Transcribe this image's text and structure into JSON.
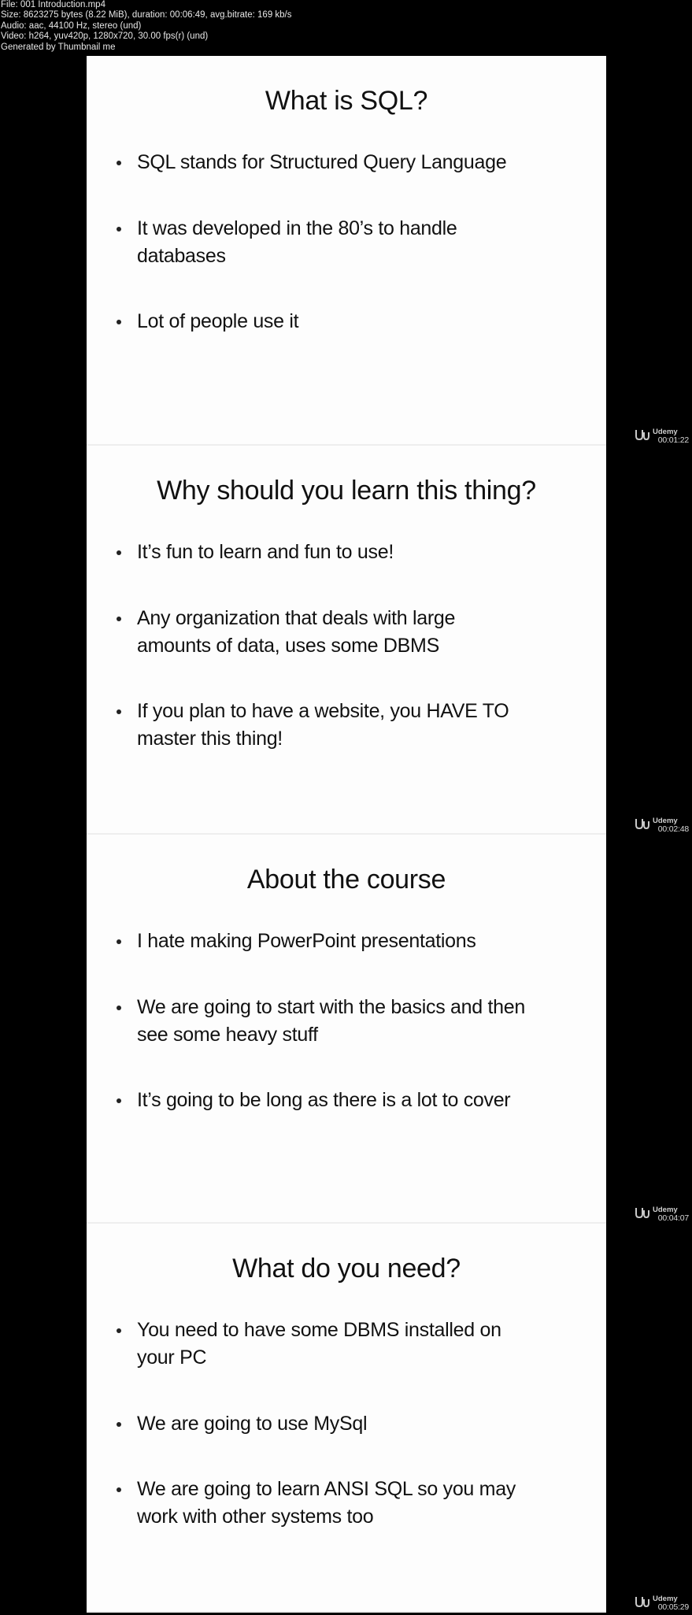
{
  "file_info": {
    "lines": [
      "File: 001 Introduction.mp4",
      "Size: 8623275 bytes (8.22 MiB), duration: 00:06:49, avg.bitrate: 169 kb/s",
      "Audio: aac, 44100 Hz, stereo (und)",
      "Video: h264, yuv420p, 1280x720, 30.00 fps(r) (und)",
      "Generated by Thumbnail me"
    ]
  },
  "watermark": {
    "brand": "Udemy",
    "icon": "udemy-logo-icon"
  },
  "slides": [
    {
      "title": "What is SQL?",
      "timestamp": "00:01:22",
      "bullets": [
        [
          "SQL stands for Structured Query Language"
        ],
        [
          "It was developed in the 80’s to handle",
          "databases"
        ],
        [
          "Lot of people use it"
        ]
      ]
    },
    {
      "title": "Why should you learn this thing?",
      "timestamp": "00:02:48",
      "bullets": [
        [
          "It’s fun to learn and fun to use!"
        ],
        [
          "Any organization that deals with large",
          "amounts of data, uses some DBMS"
        ],
        [
          "If you plan to have a website, you HAVE TO",
          "master this thing!"
        ]
      ]
    },
    {
      "title": "About the course",
      "timestamp": "00:04:07",
      "bullets": [
        [
          "I hate making PowerPoint presentations"
        ],
        [
          "We are going to start with the basics and then",
          "see some heavy stuff"
        ],
        [
          "It’s going to be long as there is a lot to cover"
        ]
      ]
    },
    {
      "title": "What do you need?",
      "timestamp": "00:05:29",
      "bullets": [
        [
          "You need to have some DBMS installed on",
          "your PC"
        ],
        [
          "We are going to use MySql"
        ],
        [
          "We are going to learn ANSI SQL so you may",
          "work with other systems too"
        ]
      ]
    }
  ]
}
